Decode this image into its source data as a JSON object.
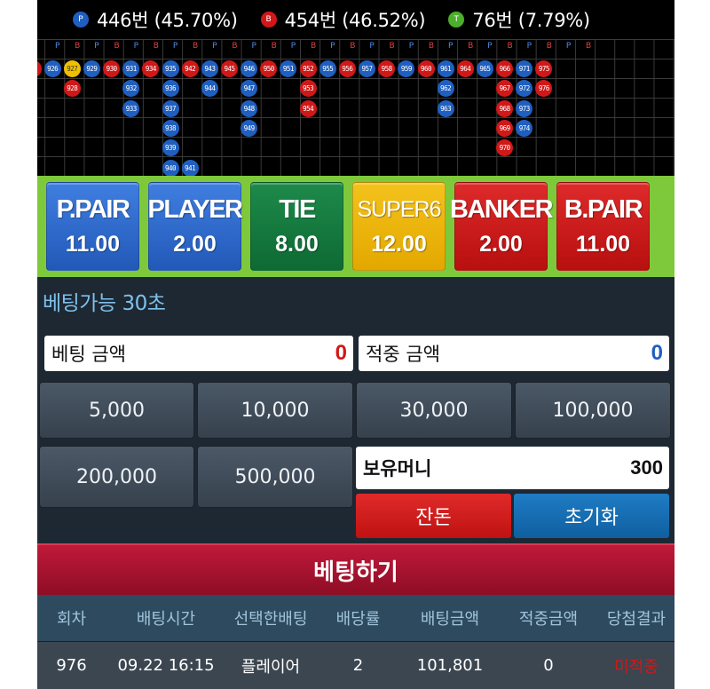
{
  "stats": {
    "player": {
      "icon": "P",
      "text": "446번 (45.70%)",
      "color": "#1f5fc0"
    },
    "banker": {
      "icon": "B",
      "text": "454번 (46.52%)",
      "color": "#d01818"
    },
    "tie": {
      "icon": "T",
      "text": "76번 (7.79%)",
      "color": "#4caf2a"
    }
  },
  "roadmap": {
    "header": [
      "P",
      "B",
      "P",
      "B",
      "P",
      "B",
      "P",
      "B",
      "P",
      "B",
      "P",
      "B",
      "P",
      "B",
      "P",
      "B",
      "P",
      "B",
      "P",
      "B",
      "P",
      "B",
      "P",
      "B",
      "P",
      "B",
      "P",
      "B"
    ],
    "columns": [
      {
        "side": "B",
        "balls": [
          "5"
        ]
      },
      {
        "side": "P",
        "balls": [
          "926"
        ]
      },
      {
        "side": "T",
        "balls": [
          "927"
        ],
        "extra": [
          {
            "side": "B",
            "n": "928"
          }
        ]
      },
      {
        "side": "P",
        "balls": [
          "929"
        ]
      },
      {
        "side": "B",
        "balls": [
          "930"
        ]
      },
      {
        "side": "P",
        "balls": [
          "931",
          "932",
          "933"
        ]
      },
      {
        "side": "B",
        "balls": [
          "934"
        ]
      },
      {
        "side": "P",
        "balls": [
          "935",
          "936",
          "937",
          "938",
          "939",
          "940"
        ],
        "extra": [
          {
            "side": "P",
            "n": "941"
          }
        ]
      },
      {
        "side": "B",
        "balls": [
          "942"
        ]
      },
      {
        "side": "P",
        "balls": [
          "943",
          "944"
        ]
      },
      {
        "side": "B",
        "balls": [
          "945"
        ]
      },
      {
        "side": "P",
        "balls": [
          "946",
          "947",
          "948",
          "949"
        ]
      },
      {
        "side": "B",
        "balls": [
          "950"
        ]
      },
      {
        "side": "P",
        "balls": [
          "951"
        ]
      },
      {
        "side": "B",
        "balls": [
          "952",
          "953",
          "954"
        ]
      },
      {
        "side": "P",
        "balls": [
          "955"
        ]
      },
      {
        "side": "B",
        "balls": [
          "956"
        ]
      },
      {
        "side": "P",
        "balls": [
          "957"
        ]
      },
      {
        "side": "B",
        "balls": [
          "958"
        ]
      },
      {
        "side": "P",
        "balls": [
          "959"
        ]
      },
      {
        "side": "B",
        "balls": [
          "960"
        ]
      },
      {
        "side": "P",
        "balls": [
          "961",
          "962",
          "963"
        ]
      },
      {
        "side": "B",
        "balls": [
          "964"
        ]
      },
      {
        "side": "P",
        "balls": [
          "965"
        ]
      },
      {
        "side": "B",
        "balls": [
          "966",
          "967",
          "968",
          "969",
          "970"
        ]
      },
      {
        "side": "P",
        "balls": [
          "971",
          "972",
          "973",
          "974"
        ]
      },
      {
        "side": "B",
        "balls": [
          "975",
          "976"
        ]
      }
    ]
  },
  "bets": [
    {
      "label": "P.PAIR",
      "odds": "11.00",
      "style": "blue"
    },
    {
      "label": "PLAYER",
      "odds": "2.00",
      "style": "blue"
    },
    {
      "label": "TIE",
      "odds": "8.00",
      "style": "green"
    },
    {
      "label": "SUPER6",
      "odds": "12.00",
      "style": "yellow"
    },
    {
      "label": "BANKER",
      "odds": "2.00",
      "style": "red"
    },
    {
      "label": "B.PAIR",
      "odds": "11.00",
      "style": "red"
    }
  ],
  "timer": "베팅가능 30초",
  "bet_amount": {
    "label": "베팅 금액",
    "value": "0",
    "color": "#d01818"
  },
  "win_amount": {
    "label": "적중 금액",
    "value": "0",
    "color": "#1f5fc0"
  },
  "chips": [
    "5,000",
    "10,000",
    "30,000",
    "100,000",
    "200,000",
    "500,000"
  ],
  "balance": {
    "label": "보유머니",
    "value": "300"
  },
  "change_label": "잔돈",
  "reset_label": "초기화",
  "submit_label": "베팅하기",
  "table": {
    "headers": [
      "회차",
      "배팅시간",
      "선택한배팅",
      "배당률",
      "배팅금액",
      "적중금액",
      "당첨결과"
    ],
    "rows": [
      [
        "976",
        "09.22 16:15",
        "플레이어",
        "2",
        "101,801",
        "0",
        "미적중"
      ]
    ],
    "result_color": "#d01818"
  }
}
